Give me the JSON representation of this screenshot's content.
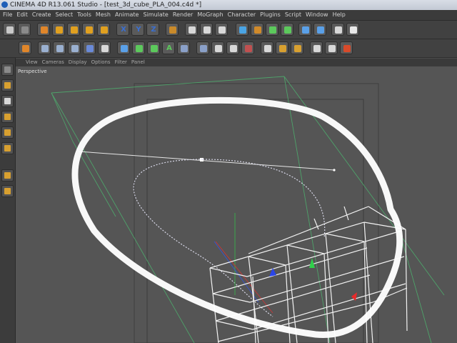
{
  "window": {
    "title": "CINEMA 4D R13.061 Studio - [test_3d_cube_PLA_004.c4d *]"
  },
  "menu": [
    "File",
    "Edit",
    "Create",
    "Select",
    "Tools",
    "Mesh",
    "Animate",
    "Simulate",
    "Render",
    "MoGraph",
    "Character",
    "Plugins",
    "Script",
    "Window",
    "Help"
  ],
  "toolbar1": {
    "buttons": [
      {
        "name": "undo-icon",
        "color": "#c9c9c9"
      },
      {
        "name": "redo-icon",
        "color": "#8a8a8a"
      },
      {
        "name": "live-selection-icon",
        "color": "#e0862a"
      },
      {
        "name": "move-icon",
        "color": "#e0a020"
      },
      {
        "name": "scale-icon",
        "color": "#e0a020"
      },
      {
        "name": "rotate-icon",
        "color": "#e0a020"
      },
      {
        "name": "recent-tools-icon",
        "color": "#e0a020"
      },
      {
        "name": "x-axis-lock-icon",
        "color": "#3a6fd1",
        "text": "X"
      },
      {
        "name": "y-axis-lock-icon",
        "color": "#3a6fd1",
        "text": "Y"
      },
      {
        "name": "z-axis-lock-icon",
        "color": "#3a6fd1",
        "text": "Z"
      },
      {
        "name": "coordinate-system-icon",
        "color": "#c98a2a"
      },
      {
        "name": "render-view-icon",
        "color": "#d8d8d8"
      },
      {
        "name": "render-picture-viewer-icon",
        "color": "#d8d8d8"
      },
      {
        "name": "render-settings-icon",
        "color": "#d8d8d8"
      },
      {
        "name": "cube-object-icon",
        "color": "#4aa4e4"
      },
      {
        "name": "spline-pen-icon",
        "color": "#d08a2a"
      },
      {
        "name": "subdivision-surface-icon",
        "color": "#5cc95c"
      },
      {
        "name": "array-generator-icon",
        "color": "#5cc95c"
      },
      {
        "name": "deformer-bend-icon",
        "color": "#5aa0e8"
      },
      {
        "name": "floor-scene-icon",
        "color": "#5aa0e8"
      },
      {
        "name": "camera-icon",
        "color": "#d8d8d8"
      },
      {
        "name": "light-icon",
        "color": "#e8e8e8"
      }
    ]
  },
  "toolbar2": {
    "buttons": [
      {
        "name": "selection-mode-icon",
        "color": "#e0862a"
      },
      {
        "name": "points-mode-icon",
        "color": "#9ab0d0"
      },
      {
        "name": "edges-mode-icon",
        "color": "#9ab0d0"
      },
      {
        "name": "polygons-mode-icon",
        "color": "#9ab0d0"
      },
      {
        "name": "model-mode-icon",
        "color": "#6a8ad8"
      },
      {
        "name": "texture-mode-icon",
        "color": "#d8d8d8"
      },
      {
        "name": "workplane-icon",
        "color": "#5aa0e8"
      },
      {
        "name": "cloner-icon",
        "color": "#5cc95c"
      },
      {
        "name": "fracture-icon",
        "color": "#5cc95c"
      },
      {
        "name": "text-object-icon",
        "color": "#5cc95c",
        "text": "A"
      },
      {
        "name": "grid-object-icon",
        "color": "#8aa0c8"
      },
      {
        "name": "plane-object-icon",
        "color": "#8aa0c8"
      },
      {
        "name": "sphere-object-icon",
        "color": "#d8d8d8"
      },
      {
        "name": "instance-object-icon",
        "color": "#d8d8d8"
      },
      {
        "name": "tag-object-icon",
        "color": "#c05050"
      },
      {
        "name": "sketch-tag-icon",
        "color": "#d8d8d8"
      },
      {
        "name": "joint-icon",
        "color": "#d8a030"
      },
      {
        "name": "weight-tool-icon",
        "color": "#d8a030"
      },
      {
        "name": "animation-record-icon",
        "color": "#d8d8d8"
      },
      {
        "name": "keyframe-icon",
        "color": "#d8d8d8"
      },
      {
        "name": "play-animation-icon",
        "color": "#d84a2a"
      }
    ]
  },
  "left_palette": [
    {
      "name": "make-editable-icon",
      "color": "#8a8a8a"
    },
    {
      "name": "model-tool-icon",
      "color": "#d8a030"
    },
    {
      "name": "texture-tool-icon",
      "color": "#d8d8d8"
    },
    {
      "name": "object-axis-icon",
      "color": "#d8a030"
    },
    {
      "name": "points-tool-icon",
      "color": "#d8a030"
    },
    {
      "name": "polygon-tool-icon",
      "color": "#d8a030"
    },
    {
      "name": "snapping-icon",
      "color": "#d8a030"
    },
    {
      "name": "magnet-icon",
      "color": "#d8a030"
    }
  ],
  "viewport": {
    "menu": [
      "View",
      "Cameras",
      "Display",
      "Options",
      "Filter",
      "Panel"
    ],
    "label": "Perspective"
  }
}
